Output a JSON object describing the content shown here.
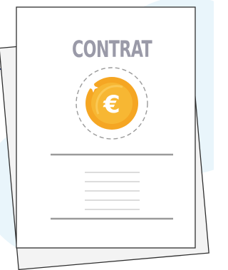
{
  "document": {
    "title": "CONTRAT",
    "currency_symbol": "€"
  },
  "colors": {
    "background_blob": "#e9f5fb",
    "paper": "#ffffff",
    "back_sheet": "#f3f3f3",
    "outline": "#2f2f2f",
    "title": "#9a9aa8",
    "rule": "#9a9a9a",
    "text_line": "#dcdcdc",
    "dash_circle": "#9a9a9a",
    "coin_outer": "#f5a623",
    "coin_inner": "#f7b733",
    "coin_symbol": "#ffffff",
    "accent_line": "#3b4a8a"
  }
}
